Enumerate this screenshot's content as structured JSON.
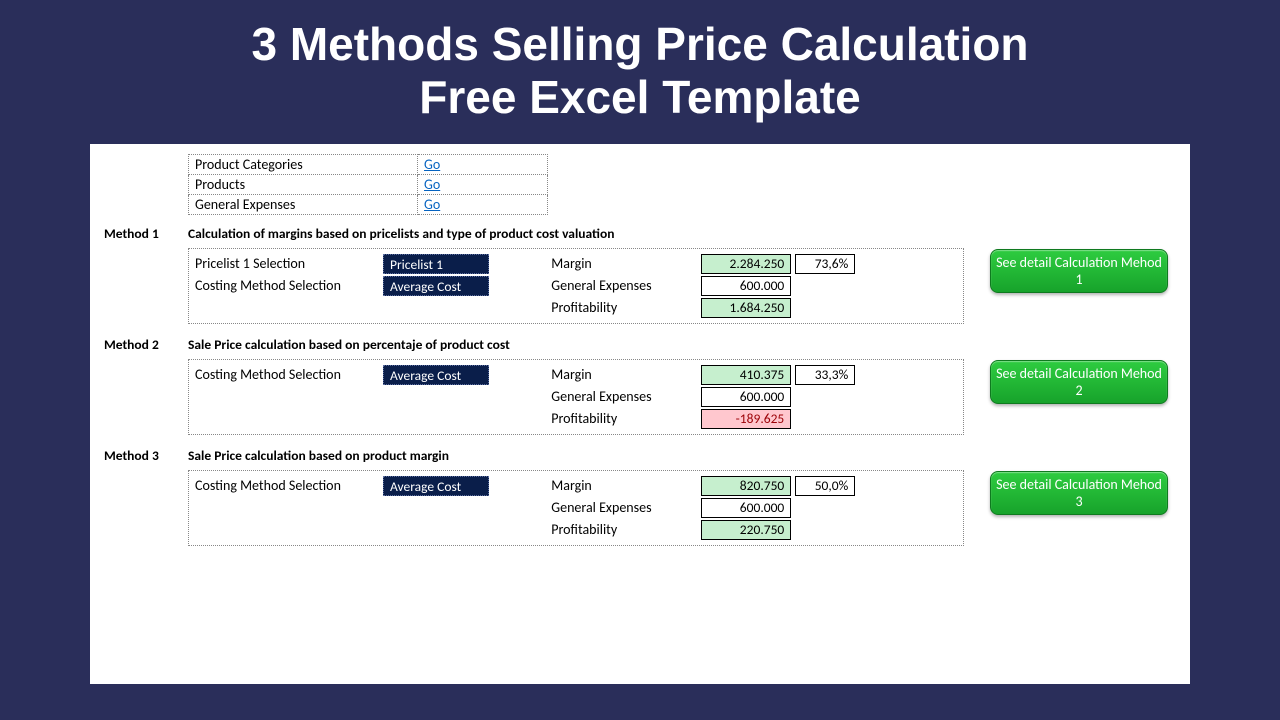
{
  "title_line1": "3 Methods Selling Price Calculation",
  "title_line2": "Free Excel Template",
  "nav": [
    {
      "label": "Product Categories",
      "link": "Go"
    },
    {
      "label": "Products",
      "link": "Go"
    },
    {
      "label": "General Expenses",
      "link": "Go"
    }
  ],
  "res_labels": {
    "margin": "Margin",
    "genexp": "General Expenses",
    "profit": "Profitability"
  },
  "methods": [
    {
      "label": "Method 1",
      "heading": "Calculation of margins based on pricelists and type of product cost valuation",
      "selections": [
        {
          "label": "Pricelist 1 Selection",
          "value": "Pricelist 1"
        },
        {
          "label": "Costing Method Selection",
          "value": "Average Cost"
        }
      ],
      "margin": "2.284.250",
      "margin_pos": true,
      "pct": "73,6%",
      "genexp": "600.000",
      "profit": "1.684.250",
      "profit_pos": true,
      "button": "See detail Calculation Mehod 1"
    },
    {
      "label": "Method 2",
      "heading": "Sale Price calculation based on percentaje of product cost",
      "selections": [
        {
          "label": "Costing Method Selection",
          "value": "Average Cost"
        }
      ],
      "margin": "410.375",
      "margin_pos": true,
      "pct": "33,3%",
      "genexp": "600.000",
      "profit": "-189.625",
      "profit_pos": false,
      "button": "See detail Calculation Mehod 2"
    },
    {
      "label": "Method 3",
      "heading": "Sale Price calculation based on product margin",
      "selections": [
        {
          "label": "Costing Method Selection",
          "value": "Average Cost"
        }
      ],
      "margin": "820.750",
      "margin_pos": true,
      "pct": "50,0%",
      "genexp": "600.000",
      "profit": "220.750",
      "profit_pos": true,
      "button": "See detail Calculation Mehod 3"
    }
  ]
}
